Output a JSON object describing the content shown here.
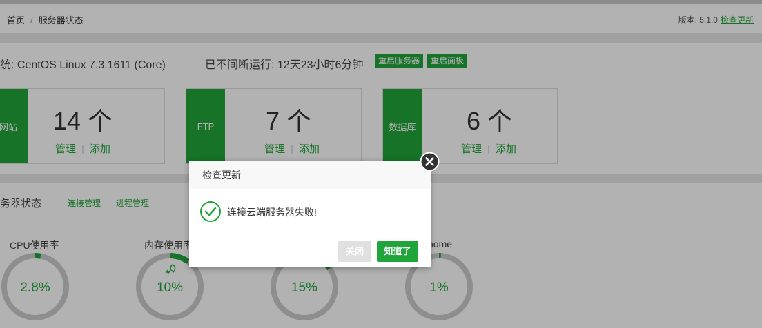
{
  "breadcrumb": {
    "home": "首页",
    "separator": "/",
    "current": "服务器状态"
  },
  "version": {
    "label": "版本: 5.1.0",
    "check_update": "检查更新"
  },
  "system": {
    "os": "统: CentOS Linux 7.3.1611 (Core)",
    "uptime": "已不间断运行: 12天23小时6分钟",
    "restart_server": "重启服务器",
    "restart_panel": "重启面板"
  },
  "cards": [
    {
      "name": "网站",
      "count": "14 个",
      "manage": "管理",
      "add": "添加"
    },
    {
      "name": "FTP",
      "count": "7 个",
      "manage": "管理",
      "add": "添加"
    },
    {
      "name": "数据库",
      "count": "6 个",
      "manage": "管理",
      "add": "添加"
    }
  ],
  "status": {
    "title": "务器状态",
    "conn_manage": "连接管理",
    "proc_manage": "进程管理",
    "gauges": [
      {
        "label": "CPU使用率",
        "value": "2.8%",
        "percent": 2.8
      },
      {
        "label": "内存使用率",
        "value": "10%",
        "percent": 10
      },
      {
        "label": "",
        "value": "15%",
        "percent": 15
      },
      {
        "label": "home",
        "value": "1%",
        "percent": 1
      }
    ]
  },
  "dialog": {
    "title": "检查更新",
    "message": "连接云端服务器失败!",
    "close_label": "关闭",
    "ok_label": "知道了"
  },
  "colors": {
    "accent": "#20a53a",
    "gauge_track": "#cccccc",
    "disabled": "#e0e0e0"
  }
}
